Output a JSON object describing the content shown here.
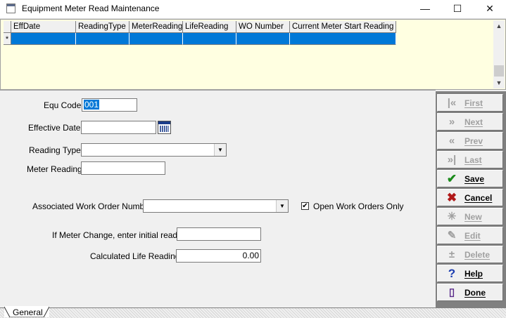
{
  "window": {
    "title": "Equipment Meter Read Maintenance",
    "minimize_glyph": "—",
    "maximize_glyph": "☐",
    "close_glyph": "✕"
  },
  "grid": {
    "columns": [
      "EffDate",
      "ReadingType",
      "MeterReading",
      "LifeReading",
      "WO Number",
      "Current Meter Start Reading"
    ],
    "row_indicator": "*"
  },
  "form": {
    "equ_code_label": "Equ Code:",
    "equ_code_value": "001",
    "effective_date_label": "Effective Date:",
    "effective_date_value": "",
    "reading_type_label": "Reading Type:",
    "reading_type_value": "",
    "meter_reading_label": "Meter Reading:",
    "meter_reading_value": "",
    "work_order_label": "Associated Work Order Number:",
    "work_order_value": "",
    "open_orders_label": "Open Work Orders Only",
    "open_orders_checked": true,
    "meter_change_label": "If Meter Change, enter initial reading:",
    "meter_change_value": "",
    "calc_life_label": "Calculated Life Reading:",
    "calc_life_value": "0.00"
  },
  "side_buttons": [
    {
      "label": "First",
      "icon": "first-icon",
      "enabled": false
    },
    {
      "label": "Next",
      "icon": "next-icon",
      "enabled": false
    },
    {
      "label": "Prev",
      "icon": "prev-icon",
      "enabled": false
    },
    {
      "label": "Last",
      "icon": "last-icon",
      "enabled": false
    },
    {
      "label": "Save",
      "icon": "checkmark-icon",
      "enabled": true
    },
    {
      "label": "Cancel",
      "icon": "x-icon",
      "enabled": true
    },
    {
      "label": "New",
      "icon": "new-icon",
      "enabled": false
    },
    {
      "label": "Edit",
      "icon": "edit-icon",
      "enabled": false
    },
    {
      "label": "Delete",
      "icon": "delete-icon",
      "enabled": false
    },
    {
      "label": "Help",
      "icon": "question-icon",
      "enabled": true
    },
    {
      "label": "Done",
      "icon": "door-icon",
      "enabled": true
    }
  ],
  "tabs": [
    "General"
  ],
  "colors": {
    "grid_bg": "#ffffe1",
    "selection": "#0078d7",
    "save_green": "#1a8a1a",
    "cancel_red": "#b01818"
  }
}
